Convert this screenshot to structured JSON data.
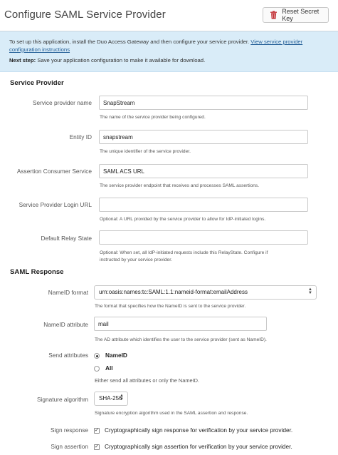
{
  "header": {
    "title": "Configure SAML Service Provider",
    "reset_button": "Reset Secret Key",
    "reset_icon": "trash-icon",
    "reset_icon_color": "#c0282d"
  },
  "info": {
    "line1": "To set up this application, install the Duo Access Gateway and then configure your service provider.",
    "link": "View service provider configuration instructions",
    "next_step_label": "Next step:",
    "next_step_text": "Save your application configuration to make it available for download."
  },
  "service_provider": {
    "section_title": "Service Provider",
    "sp_name": {
      "label": "Service provider name",
      "value": "SnapStream",
      "help": "The name of the service provider being configured."
    },
    "entity_id": {
      "label": "Entity ID",
      "value": "snapstream",
      "help": "The unique identifier of the service provider."
    },
    "acs": {
      "label": "Assertion Consumer Service",
      "value": "SAML ACS URL",
      "help": "The service provider endpoint that receives and processes SAML assertions."
    },
    "login_url": {
      "label": "Service Provider Login URL",
      "value": "",
      "help": "Optional: A URL provided by the service provider to allow for IdP-initiated logins."
    },
    "relay_state": {
      "label": "Default Relay State",
      "value": "",
      "help_line1": "Optional: When set, all IdP-initiated requests include this RelayState. Configure if",
      "help_line2": "instructed by your service provider."
    }
  },
  "saml_response": {
    "section_title": "SAML Response",
    "nameid_format": {
      "label": "NameID format",
      "value": "urn:oasis:names:tc:SAML:1.1:nameid-format:emailAddress",
      "help": "The format that specifies how the NameID is sent to the service provider."
    },
    "nameid_attribute": {
      "label": "NameID attribute",
      "value": "mail",
      "help": "The AD attribute which identifies the user to the service provider (sent as NameID)."
    },
    "send_attributes": {
      "label": "Send attributes",
      "options": [
        "NameID",
        "All"
      ],
      "selected": "NameID",
      "help": "Either send all attributes or only the NameID."
    },
    "signature_algorithm": {
      "label": "Signature algorithm",
      "value": "SHA-256",
      "help": "Signature encryption algorithm used in the SAML assertion and response."
    },
    "sign_response": {
      "label": "Sign response",
      "checked": true,
      "text": "Cryptographically sign response for verification by your service provider."
    },
    "sign_assertion": {
      "label": "Sign assertion",
      "checked": true,
      "text": "Cryptographically sign assertion for verification by your service provider."
    }
  }
}
